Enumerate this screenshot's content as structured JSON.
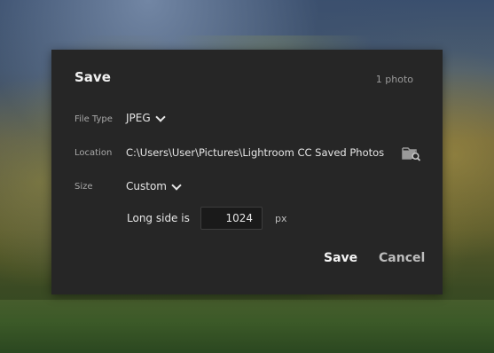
{
  "dialog": {
    "title": "Save",
    "photo_count": "1 photo",
    "file_type": {
      "label": "File Type",
      "value": "JPEG"
    },
    "location": {
      "label": "Location",
      "value": "C:\\Users\\User\\Pictures\\Lightroom CC Saved Photos"
    },
    "size": {
      "label": "Size",
      "value": "Custom"
    },
    "long_side": {
      "label": "Long side is",
      "value": "1024",
      "unit": "px"
    },
    "buttons": {
      "save": "Save",
      "cancel": "Cancel"
    }
  },
  "colors": {
    "dialog_bg": "#262626",
    "input_bg": "#1a1a1a",
    "text_primary": "#f2f2f2",
    "text_secondary": "#a8a8a8"
  },
  "icons": {
    "location_browse": "folder-search-icon",
    "dropdown": "chevron-down-icon"
  }
}
